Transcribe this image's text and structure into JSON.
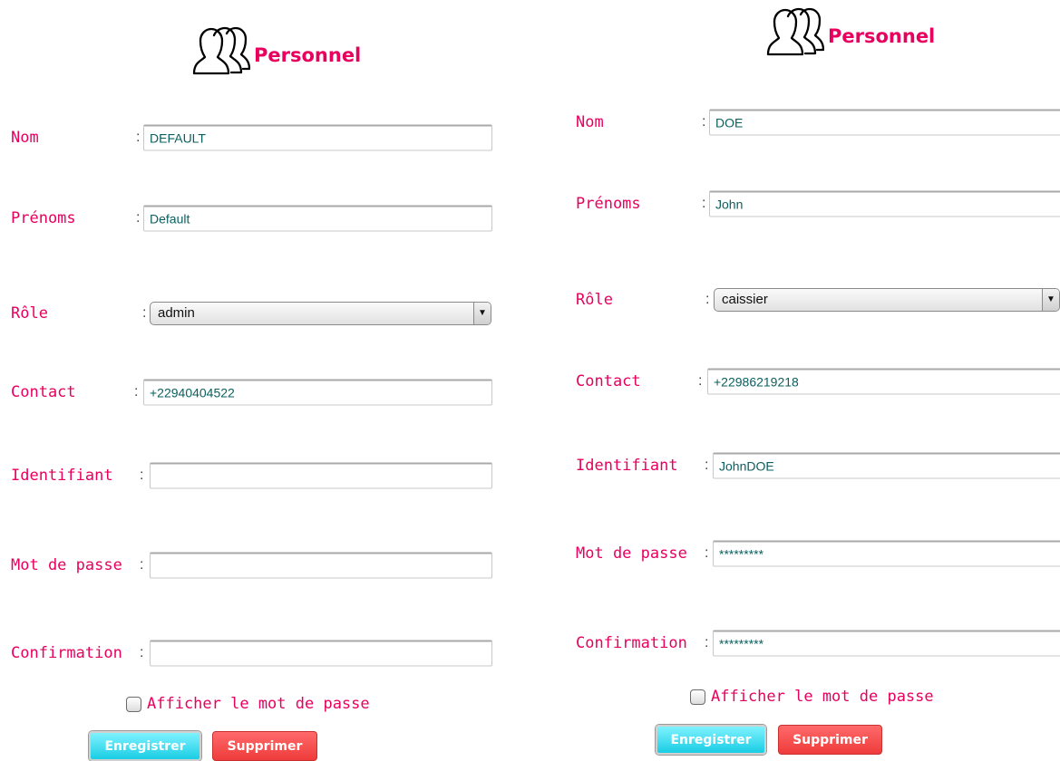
{
  "forms": [
    {
      "title": "Personnel",
      "labels": {
        "nom": "Nom",
        "prenoms": "Prénoms",
        "role": "Rôle",
        "contact": "Contact",
        "identifiant": "Identifiant",
        "mot_de_passe": "Mot de passe",
        "confirmation": "Confirmation"
      },
      "colon": ":",
      "values": {
        "nom": "DEFAULT",
        "prenoms": "Default",
        "role": "admin",
        "contact": "+22940404522",
        "identifiant": "",
        "mot_de_passe": "",
        "confirmation": ""
      },
      "show_password_label": "Afficher le mot de passe",
      "show_password_checked": false,
      "save_label": "Enregistrer",
      "delete_label": "Supprimer"
    },
    {
      "title": "Personnel",
      "labels": {
        "nom": "Nom",
        "prenoms": "Prénoms",
        "role": "Rôle",
        "contact": "Contact",
        "identifiant": "Identifiant",
        "mot_de_passe": "Mot de passe",
        "confirmation": "Confirmation"
      },
      "colon": ":",
      "values": {
        "nom": "DOE",
        "prenoms": "John",
        "role": "caissier",
        "contact": "+22986219218",
        "identifiant": "JohnDOE",
        "mot_de_passe": "*********",
        "confirmation": "*********"
      },
      "show_password_label": "Afficher le mot de passe",
      "show_password_checked": false,
      "save_label": "Enregistrer",
      "delete_label": "Supprimer"
    }
  ],
  "colors": {
    "accent": "#e8005f",
    "field_text": "#0a5f5f",
    "save_button": "#19cde4",
    "delete_button": "#ef3b3b"
  },
  "icons": {
    "header": "users-group-icon",
    "select_arrow": "triangle-down-icon"
  }
}
